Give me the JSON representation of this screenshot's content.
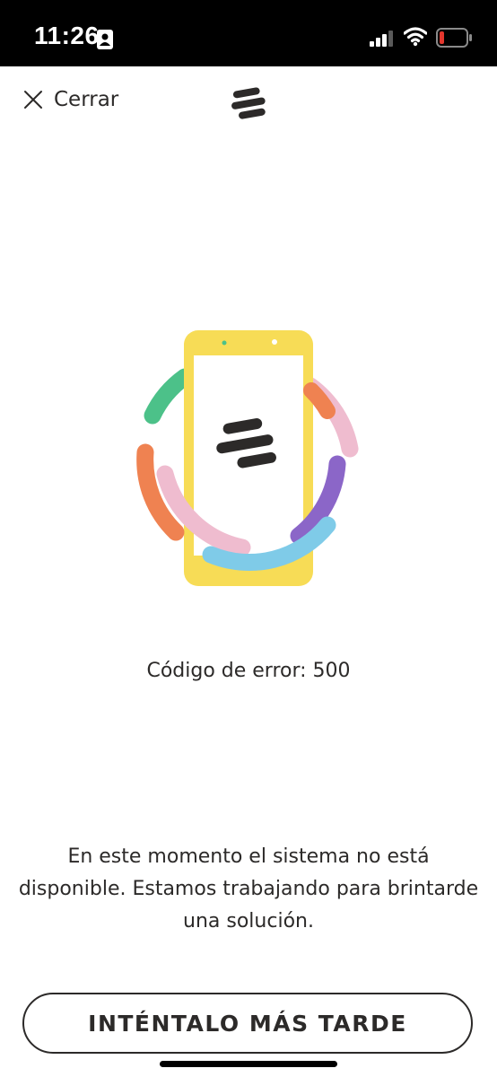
{
  "status_bar": {
    "time": "11:26",
    "icons": [
      "person-card-icon",
      "cellular-signal-icon",
      "wifi-icon",
      "battery-low-icon"
    ],
    "battery_level": 0.15,
    "battery_color": "#e3362d"
  },
  "header": {
    "close_label": "Cerrar",
    "close_icon": "close-icon",
    "logo_icon": "brand-logo-icon"
  },
  "illustration": {
    "icon": "phone-illustration",
    "colors": {
      "phone": "#f7dc56",
      "green": "#4cc189",
      "orange": "#ef8251",
      "pink": "#efbccf",
      "purple": "#8b66c8",
      "blue": "#7fcbe8",
      "logo": "#2c2a29"
    }
  },
  "error": {
    "code_text": "Código de error: 500",
    "message": "En este momento el sistema no está disponible. Estamos trabajando para brintarde una solución."
  },
  "actions": {
    "retry_label": "INTÉNTALO MÁS TARDE"
  }
}
